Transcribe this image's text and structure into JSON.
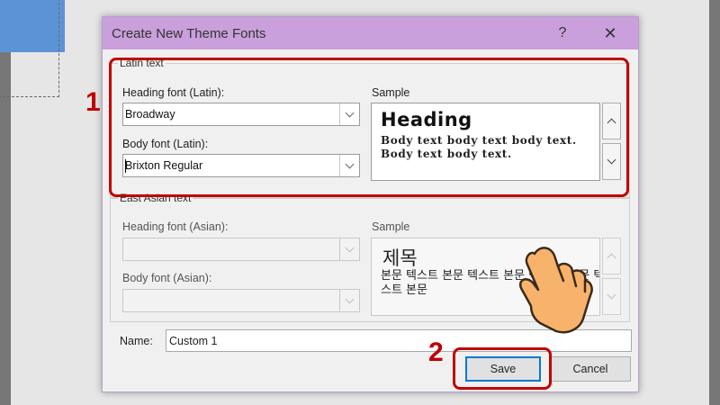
{
  "dialog": {
    "title": "Create New Theme Fonts",
    "help_icon": "question-mark-icon",
    "close_icon": "close-icon"
  },
  "latin": {
    "group_label": "Latin text",
    "heading_label": "Heading font (Latin):",
    "heading_value": "Broadway",
    "body_label": "Body font (Latin):",
    "body_value": "Brixton Regular",
    "sample_label": "Sample",
    "sample_heading": "Heading",
    "sample_body": "Body text body text body text. Body text body text."
  },
  "asian": {
    "group_label": "East Asian text",
    "heading_label": "Heading font (Asian):",
    "heading_value": "",
    "body_label": "Body font (Asian):",
    "body_value": "",
    "sample_label": "Sample",
    "sample_heading": "제목",
    "sample_body": "본문 텍스트 본문 텍스트 본문 텍스트. 본문 텍스트 본문"
  },
  "name": {
    "label": "Name:",
    "value": "Custom 1"
  },
  "buttons": {
    "save": "Save",
    "cancel": "Cancel"
  },
  "annotations": {
    "step1": "1",
    "step2": "2",
    "color": "#c00000"
  },
  "colors": {
    "titlebar": "#c9a0db",
    "default_button_border": "#0078d7"
  }
}
